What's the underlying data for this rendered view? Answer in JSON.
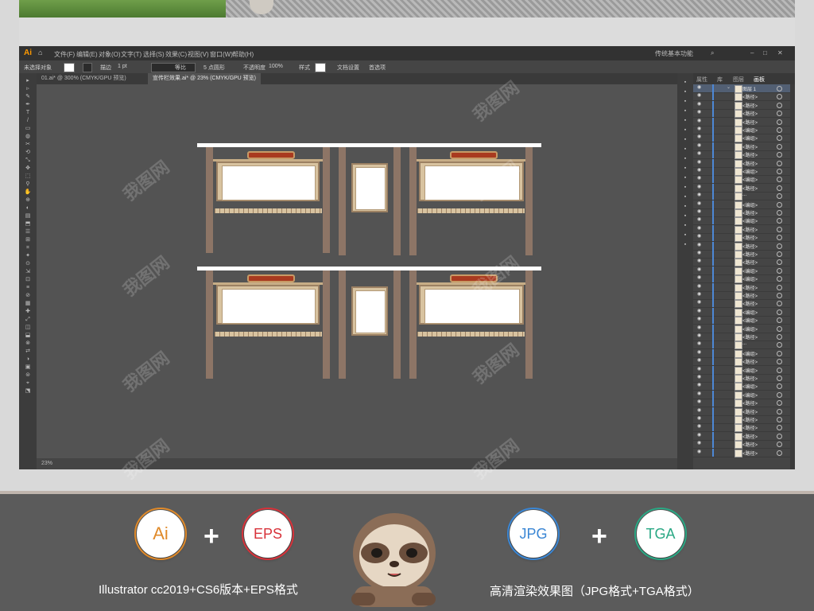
{
  "menubar": {
    "logo": "Ai",
    "items": [
      "文件(F)",
      "编辑(E)",
      "对象(O)",
      "文字(T)",
      "选择(S)",
      "效果(C)",
      "视图(V)",
      "窗口(W)",
      "帮助(H)"
    ],
    "right": "传统基本功能"
  },
  "control_bar": {
    "selection": "未选择对象",
    "stroke_label": "描边",
    "stroke_value": "1 pt",
    "brush_label": "等比",
    "points_label": "5 点圆形",
    "opacity_label": "不透明度",
    "opacity_value": "100%",
    "style_label": "样式",
    "doc_setup": "文档设置",
    "preferences": "首选项"
  },
  "tabs": [
    {
      "label": "01.ai* @ 300% (CMYK/GPU 预览)"
    },
    {
      "label": "宣传栏效果.ai* @ 23% (CMYK/GPU 预览)"
    }
  ],
  "status": {
    "zoom": "23%"
  },
  "panel": {
    "tabs": [
      "属性",
      "库",
      "图层",
      "画板"
    ],
    "layers": [
      {
        "label": "图层 1"
      },
      {
        "label": "<路径>"
      },
      {
        "label": "<路径>"
      },
      {
        "label": "<路径>"
      },
      {
        "label": "<路径>"
      },
      {
        "label": "<编组>"
      },
      {
        "label": "<编组>"
      },
      {
        "label": "<路径>"
      },
      {
        "label": "<路径>"
      },
      {
        "label": "<路径>"
      },
      {
        "label": "<编组>"
      },
      {
        "label": "<编组>"
      },
      {
        "label": "<路径>"
      },
      {
        "label": "..."
      },
      {
        "label": "<编组>"
      },
      {
        "label": "<路径>"
      },
      {
        "label": "<编组>"
      },
      {
        "label": "<路径>"
      },
      {
        "label": "<路径>"
      },
      {
        "label": "<路径>"
      },
      {
        "label": "<路径>"
      },
      {
        "label": "<路径>"
      },
      {
        "label": "<编组>"
      },
      {
        "label": "<编组>"
      },
      {
        "label": "<路径>"
      },
      {
        "label": "<路径>"
      },
      {
        "label": "<路径>"
      },
      {
        "label": "<编组>"
      },
      {
        "label": "<编组>"
      },
      {
        "label": "<编组>"
      },
      {
        "label": "<路径>"
      },
      {
        "label": "..."
      },
      {
        "label": "<编组>"
      },
      {
        "label": "<路径>"
      },
      {
        "label": "<编组>"
      },
      {
        "label": "<路径>"
      },
      {
        "label": "<编组>"
      },
      {
        "label": "<编组>"
      },
      {
        "label": "<路径>"
      },
      {
        "label": "<路径>"
      },
      {
        "label": "<路径>"
      },
      {
        "label": "<路径>"
      },
      {
        "label": "<路径>"
      },
      {
        "label": "<路径>"
      },
      {
        "label": "<路径>"
      }
    ]
  },
  "promo": {
    "badges": {
      "ai": "Ai",
      "eps": "EPS",
      "jpg": "JPG",
      "tga": "TGA"
    },
    "plus": "+",
    "caption_left": "Illustrator cc2019+CS6版本+EPS格式",
    "caption_right": "高清渲染效果图（JPG格式+TGA格式）"
  },
  "watermark": "我图网",
  "colors": {
    "ai": "#e08a2a",
    "eps": "#d8323a",
    "jpg": "#3a86d4",
    "tga": "#2aa884"
  }
}
